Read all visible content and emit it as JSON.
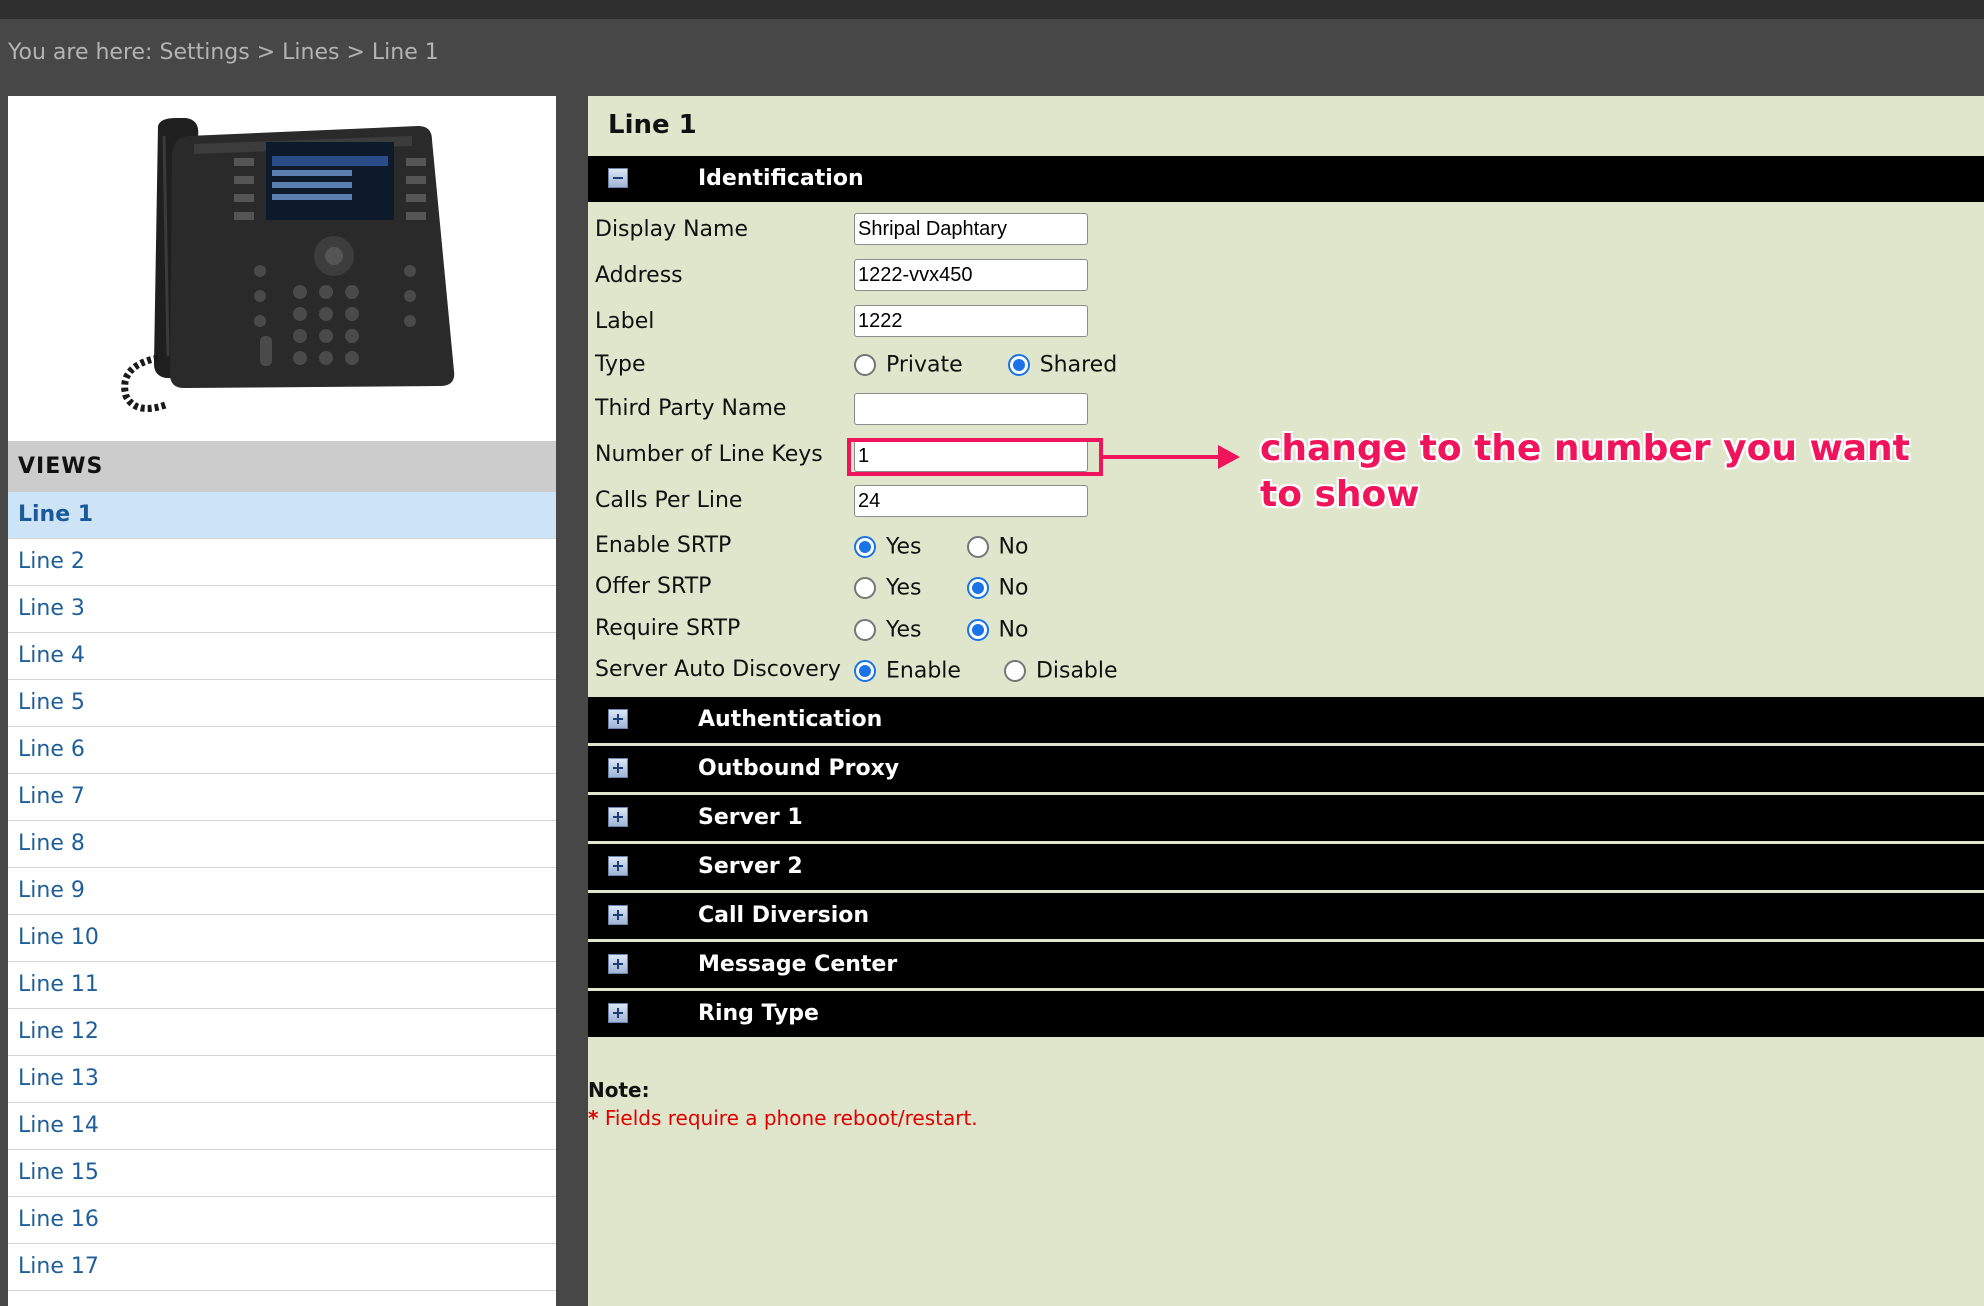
{
  "breadcrumb": [
    "You are here:",
    "Settings",
    ">",
    "Lines",
    ">",
    "Line 1"
  ],
  "sidebar": {
    "views_header": "VIEWS",
    "items": [
      "Line 1",
      "Line 2",
      "Line 3",
      "Line 4",
      "Line 5",
      "Line 6",
      "Line 7",
      "Line 8",
      "Line 9",
      "Line 10",
      "Line 11",
      "Line 12",
      "Line 13",
      "Line 14",
      "Line 15",
      "Line 16",
      "Line 17"
    ],
    "active_index": 0
  },
  "main": {
    "title": "Line 1",
    "sections": {
      "identification": "Identification",
      "authentication": "Authentication",
      "outbound_proxy": "Outbound Proxy",
      "server1": "Server 1",
      "server2": "Server 2",
      "call_diversion": "Call Diversion",
      "message_center": "Message Center",
      "ring_type": "Ring Type"
    },
    "fields": {
      "display_name": {
        "label": "Display Name",
        "value": "Shripal Daphtary"
      },
      "address": {
        "label": "Address",
        "value": "1222-vvx450"
      },
      "label": {
        "label": "Label",
        "value": "1222"
      },
      "type": {
        "label": "Type",
        "options": [
          "Private",
          "Shared"
        ],
        "selected": "Shared"
      },
      "third_party_name": {
        "label": "Third Party Name",
        "value": ""
      },
      "number_of_line_keys": {
        "label": "Number of Line Keys",
        "value": "1"
      },
      "calls_per_line": {
        "label": "Calls Per Line",
        "value": "24"
      },
      "enable_srtp": {
        "label": "Enable SRTP",
        "options": [
          "Yes",
          "No"
        ],
        "selected": "Yes"
      },
      "offer_srtp": {
        "label": "Offer SRTP",
        "options": [
          "Yes",
          "No"
        ],
        "selected": "No"
      },
      "require_srtp": {
        "label": "Require SRTP",
        "options": [
          "Yes",
          "No"
        ],
        "selected": "No"
      },
      "server_auto_discovery": {
        "label": "Server Auto Discovery",
        "options": [
          "Enable",
          "Disable"
        ],
        "selected": "Enable"
      }
    },
    "note": {
      "title": "Note:",
      "asterisk": "*",
      "text": "Fields require a phone reboot/restart."
    }
  },
  "annotation": {
    "text": "change to the number you want to show",
    "color": "#f0145a"
  },
  "colors": {
    "panel_bg": "#dfe6cc",
    "section_bg": "#000000",
    "active_nav": "#cde4f7",
    "link": "#1f5f99",
    "required": "#e00000"
  },
  "icons": {
    "section_collapse": "minus-icon",
    "section_expand": "plus-icon",
    "device": "desk-phone-image"
  }
}
